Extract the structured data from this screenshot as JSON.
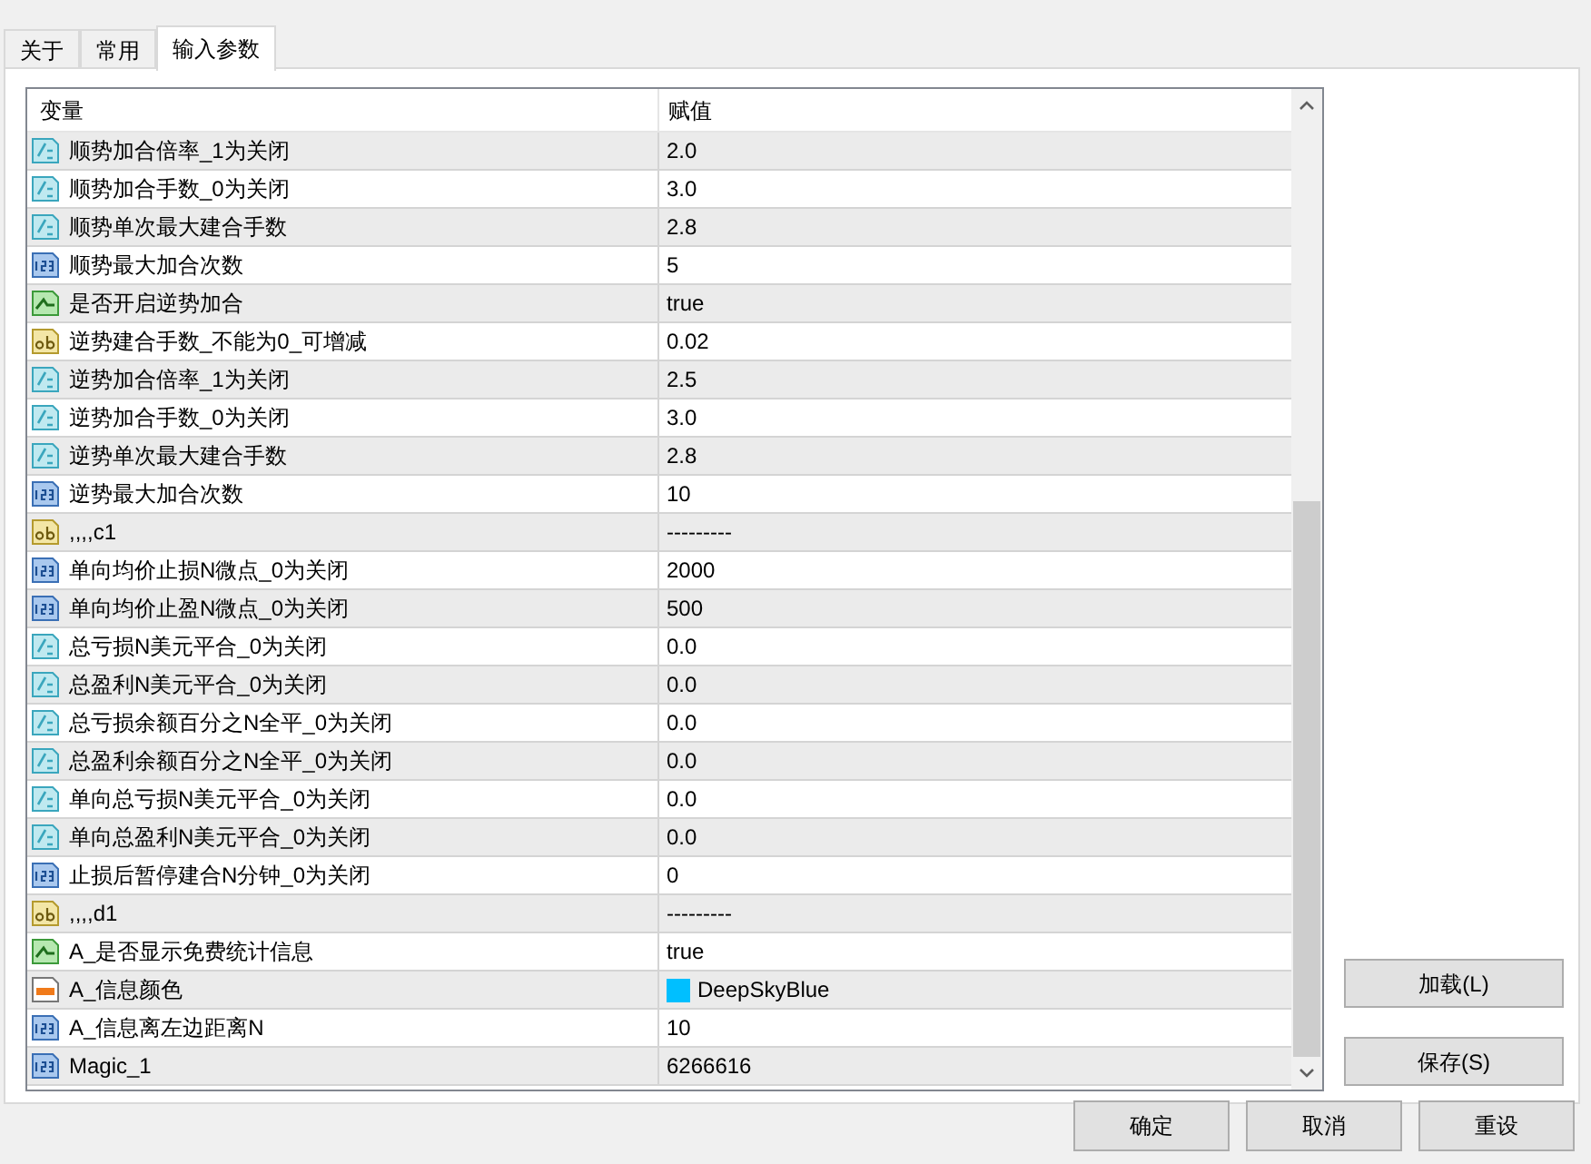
{
  "tabs": [
    {
      "label": "关于",
      "selected": false
    },
    {
      "label": "常用",
      "selected": false
    },
    {
      "label": "输入参数",
      "selected": true
    }
  ],
  "table": {
    "columns": [
      "变量",
      "赋值"
    ],
    "rows": [
      {
        "kind": "double",
        "name": "顺势加合倍率_1为关闭",
        "value": "2.0"
      },
      {
        "kind": "double",
        "name": "顺势加合手数_0为关闭",
        "value": "3.0"
      },
      {
        "kind": "double",
        "name": "顺势单次最大建合手数",
        "value": "2.8"
      },
      {
        "kind": "int",
        "name": "顺势最大加合次数",
        "value": "5"
      },
      {
        "kind": "bool",
        "name": "是否开启逆势加合",
        "value": "true"
      },
      {
        "kind": "string",
        "name": "逆势建合手数_不能为0_可增减",
        "value": "0.02"
      },
      {
        "kind": "double",
        "name": "逆势加合倍率_1为关闭",
        "value": "2.5"
      },
      {
        "kind": "double",
        "name": "逆势加合手数_0为关闭",
        "value": "3.0"
      },
      {
        "kind": "double",
        "name": "逆势单次最大建合手数",
        "value": "2.8"
      },
      {
        "kind": "int",
        "name": "逆势最大加合次数",
        "value": "10"
      },
      {
        "kind": "string",
        "name": ",,,,c1",
        "value": "---------"
      },
      {
        "kind": "int",
        "name": "单向均价止损N微点_0为关闭",
        "value": "2000"
      },
      {
        "kind": "int",
        "name": "单向均价止盈N微点_0为关闭",
        "value": "500"
      },
      {
        "kind": "double",
        "name": "总亏损N美元平合_0为关闭",
        "value": "0.0"
      },
      {
        "kind": "double",
        "name": "总盈利N美元平合_0为关闭",
        "value": "0.0"
      },
      {
        "kind": "double",
        "name": "总亏损余额百分之N全平_0为关闭",
        "value": "0.0"
      },
      {
        "kind": "double",
        "name": "总盈利余额百分之N全平_0为关闭",
        "value": "0.0"
      },
      {
        "kind": "double",
        "name": "单向总亏损N美元平合_0为关闭",
        "value": "0.0"
      },
      {
        "kind": "double",
        "name": "单向总盈利N美元平合_0为关闭",
        "value": "0.0"
      },
      {
        "kind": "int",
        "name": "止损后暂停建合N分钟_0为关闭",
        "value": "0"
      },
      {
        "kind": "string",
        "name": ",,,,d1",
        "value": "---------"
      },
      {
        "kind": "bool",
        "name": "A_是否显示免费统计信息",
        "value": "true"
      },
      {
        "kind": "color",
        "name": "A_信息颜色",
        "value": "DeepSkyBlue",
        "color": "#00bfff"
      },
      {
        "kind": "int",
        "name": "A_信息离左边距离N",
        "value": "10"
      },
      {
        "kind": "int",
        "name": "Magic_1",
        "value": "6266616"
      }
    ]
  },
  "side_buttons": [
    "加载(L)",
    "保存(S)"
  ],
  "buttons": [
    "确定",
    "取消",
    "重设"
  ]
}
